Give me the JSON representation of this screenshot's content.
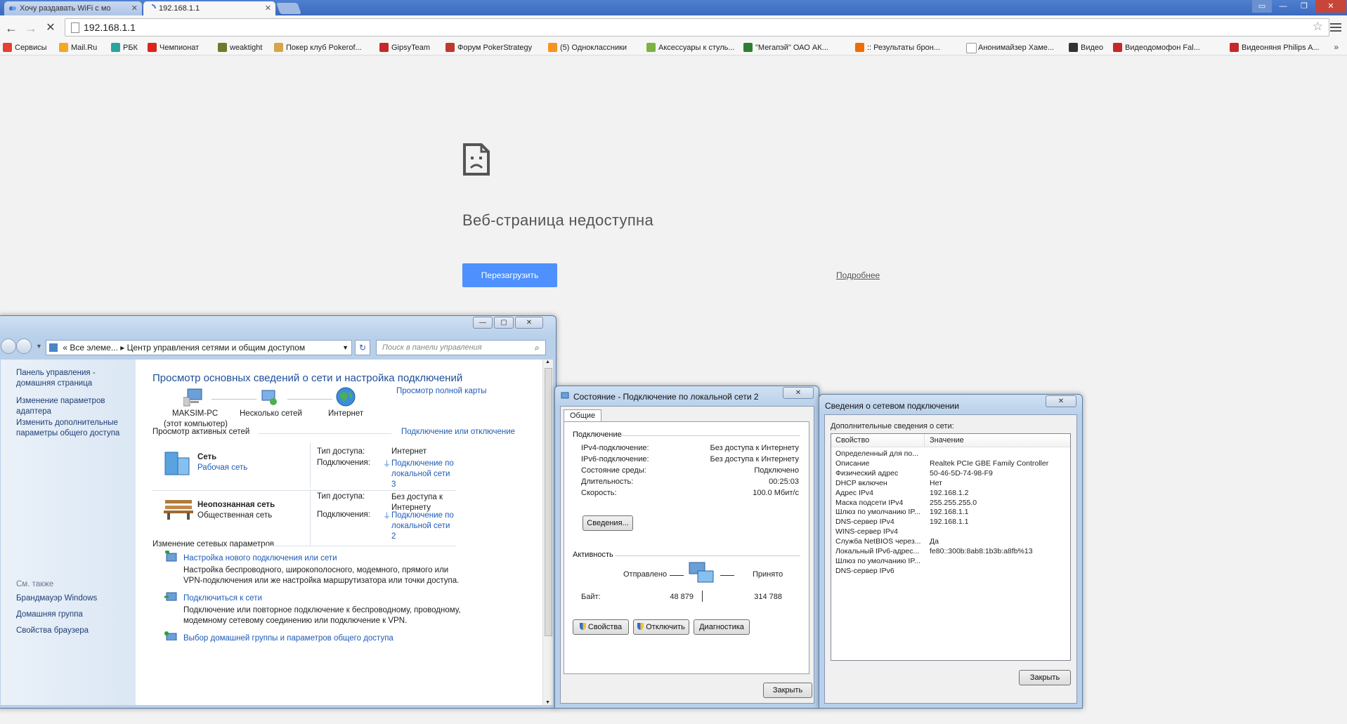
{
  "browser": {
    "tabs": [
      {
        "title": "Хочу раздавать WiFi с мо",
        "active": false
      },
      {
        "title": "192.168.1.1",
        "active": true
      }
    ],
    "url": "192.168.1.1",
    "bookmarks": [
      {
        "label": "Сервисы",
        "icon": "apps-grid-icon",
        "color": "#e34133"
      },
      {
        "label": "Mail.Ru",
        "icon": "mailru-icon",
        "color": "#f5a623"
      },
      {
        "label": "РБК",
        "icon": "rbc-icon",
        "color": "#2aa4a0"
      },
      {
        "label": "Чемпионат",
        "icon": "championat-icon",
        "color": "#d9251c"
      },
      {
        "label": "weaktight",
        "icon": "weaktight-icon",
        "color": "#6a7d2b"
      },
      {
        "label": "Покер клуб Pokerof...",
        "icon": "poker-club-icon",
        "color": "#d6a44b"
      },
      {
        "label": "GipsyTeam",
        "icon": "gipsyteam-icon",
        "color": "#c62828"
      },
      {
        "label": "Форум PokerStrategy",
        "icon": "pokerstrategy-icon",
        "color": "#c0392b"
      },
      {
        "label": "(5) Одноклассники",
        "icon": "odnoklassniki-icon",
        "color": "#f7931e"
      },
      {
        "label": "Аксессуары к стуль...",
        "icon": "accessories-icon",
        "color": "#7cb342"
      },
      {
        "label": "\"Мегапэй\" ОАО АК...",
        "icon": "megapay-icon",
        "color": "#2e7d32"
      },
      {
        "label": ":: Результаты брон...",
        "icon": "booking-icon",
        "color": "#ef6c00"
      },
      {
        "label": "Анонимайзер Хаме...",
        "icon": "page-icon",
        "color": "#ffffff"
      },
      {
        "label": "Видео",
        "icon": "video-icon",
        "color": "#333333"
      },
      {
        "label": "Видеодомофон Fal...",
        "icon": "falcon-icon",
        "color": "#c62828"
      },
      {
        "label": "Видеоняня Philips A...",
        "icon": "falcon-icon",
        "color": "#c62828"
      }
    ],
    "error": {
      "title": "Веб-страница недоступна",
      "reload": "Перезагрузить",
      "details": "Подробнее"
    }
  },
  "control_panel": {
    "breadcrumb_prefix": "«",
    "breadcrumb_1": "Все элеме...",
    "breadcrumb_sep": "▸",
    "breadcrumb_2": "Центр управления сетями и общим доступом",
    "search_placeholder": "Поиск в панели управления",
    "left_links": [
      "Панель управления - домашняя страница",
      "Изменение параметров адаптера",
      "Изменить дополнительные параметры общего доступа"
    ],
    "see_also_header": "См. также",
    "see_also": [
      "Брандмауэр Windows",
      "Домашняя группа",
      "Свойства браузера"
    ],
    "heading": "Просмотр основных сведений о сети и настройка подключений",
    "full_map": "Просмотр полной карты",
    "map": {
      "computer": "MAKSIM-PC",
      "computer_sub": "(этот компьютер)",
      "middle": "Несколько сетей",
      "internet": "Интернет"
    },
    "active_header": "Просмотр активных сетей",
    "connect_disconnect": "Подключение или отключение",
    "networks": [
      {
        "name": "Сеть",
        "type": "Рабочая сеть",
        "access_label": "Тип доступа:",
        "access_value": "Интернет",
        "conn_label": "Подключения:",
        "conn_value": "Подключение по локальной сети 3"
      },
      {
        "name": "Неопознанная сеть",
        "type": "Общественная сеть",
        "access_label": "Тип доступа:",
        "access_value": "Без доступа к Интернету",
        "conn_label": "Подключения:",
        "conn_value": "Подключение по локальной сети 2"
      }
    ],
    "change_header": "Изменение сетевых параметров",
    "tasks": [
      {
        "title": "Настройка нового подключения или сети",
        "desc": "Настройка беспроводного, широкополосного, модемного, прямого или VPN-подключения или же настройка маршрутизатора или точки доступа."
      },
      {
        "title": "Подключиться к сети",
        "desc": "Подключение или повторное подключение к беспроводному, проводному, модемному сетевому соединению или подключение к VPN."
      },
      {
        "title": "Выбор домашней группы и параметров общего доступа",
        "desc": ""
      }
    ]
  },
  "status_dialog": {
    "title": "Состояние - Подключение по локальной сети 2",
    "tab": "Общие",
    "connection_group": "Подключение",
    "rows": [
      {
        "label": "IPv4-подключение:",
        "value": "Без доступа к Интернету"
      },
      {
        "label": "IPv6-подключение:",
        "value": "Без доступа к Интернету"
      },
      {
        "label": "Состояние среды:",
        "value": "Подключено"
      },
      {
        "label": "Длительность:",
        "value": "00:25:03"
      },
      {
        "label": "Скорость:",
        "value": "100.0 Мбит/с"
      }
    ],
    "details_btn": "Сведения...",
    "activity_group": "Активность",
    "sent_label": "Отправлено",
    "received_label": "Принято",
    "bytes_label": "Байт:",
    "bytes_sent": "48 879",
    "bytes_received": "314 788",
    "properties_btn": "Свойства",
    "disable_btn": "Отключить",
    "diagnose_btn": "Диагностика",
    "close_btn": "Закрыть"
  },
  "details_dialog": {
    "title": "Сведения о сетевом подключении",
    "subtitle": "Дополнительные сведения о сети:",
    "col_property": "Свойство",
    "col_value": "Значение",
    "rows": [
      {
        "p": "Определенный для по...",
        "v": ""
      },
      {
        "p": "Описание",
        "v": "Realtek PCIe GBE Family Controller"
      },
      {
        "p": "Физический адрес",
        "v": "50-46-5D-74-98-F9"
      },
      {
        "p": "DHCP включен",
        "v": "Нет"
      },
      {
        "p": "Адрес IPv4",
        "v": "192.168.1.2"
      },
      {
        "p": "Маска подсети IPv4",
        "v": "255.255.255.0"
      },
      {
        "p": "Шлюз по умолчанию IP...",
        "v": "192.168.1.1"
      },
      {
        "p": "DNS-сервер IPv4",
        "v": "192.168.1.1"
      },
      {
        "p": "WINS-сервер IPv4",
        "v": ""
      },
      {
        "p": "Служба NetBIOS через...",
        "v": "Да"
      },
      {
        "p": "Локальный IPv6-адрес...",
        "v": "fe80::300b:8ab8:1b3b:a8fb%13"
      },
      {
        "p": "Шлюз по умолчанию IP...",
        "v": ""
      },
      {
        "p": "DNS-сервер IPv6",
        "v": ""
      }
    ],
    "close_btn": "Закрыть"
  }
}
